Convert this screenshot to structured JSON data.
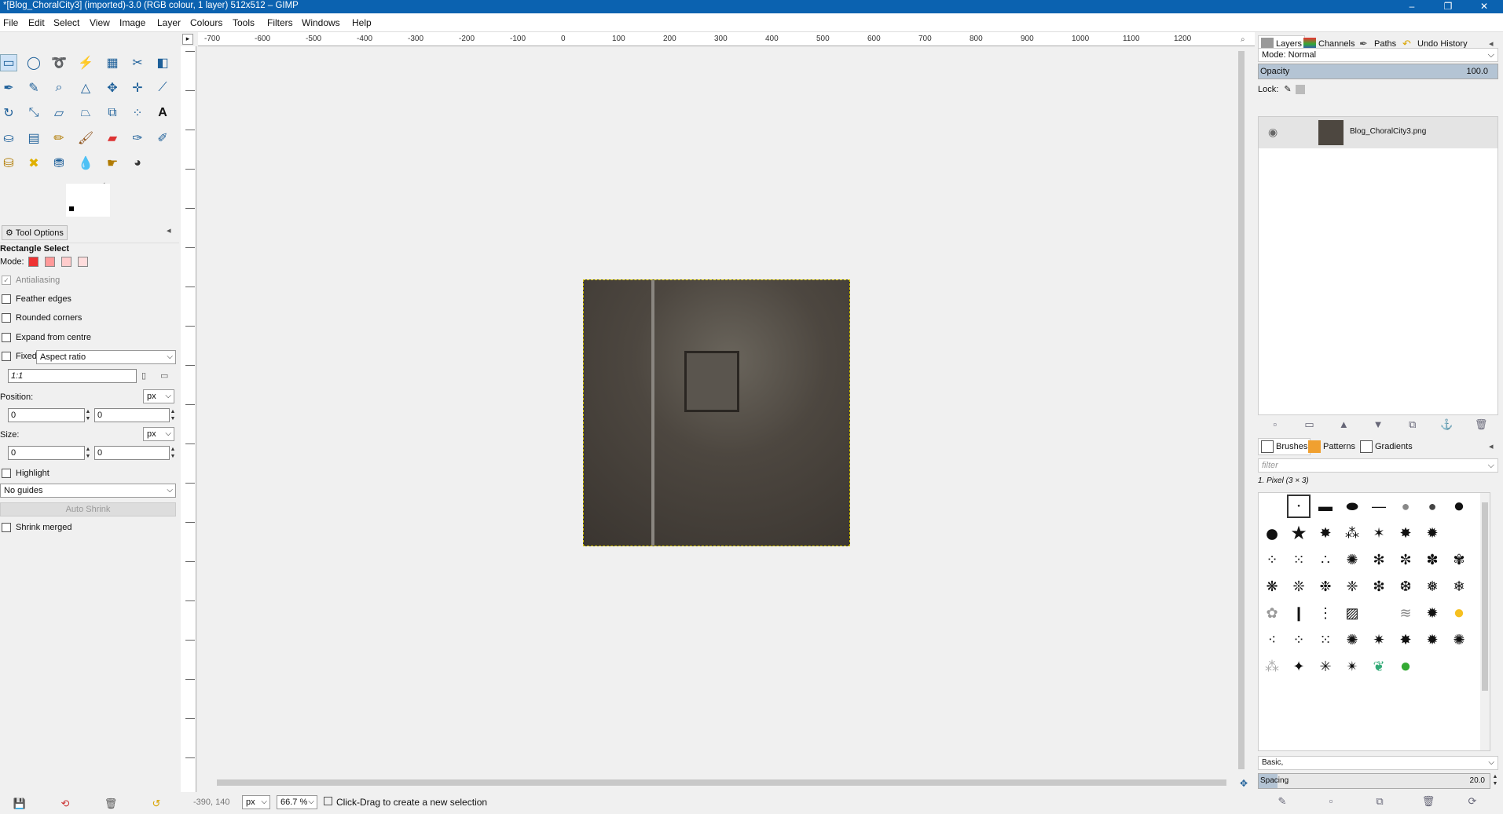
{
  "window": {
    "title": "*[Blog_ChoralCity3] (imported)-3.0 (RGB colour, 1 layer) 512x512 – GIMP",
    "minimize": "–",
    "maximize": "❐",
    "close": "✕"
  },
  "menu": [
    "File",
    "Edit",
    "Select",
    "View",
    "Image",
    "Layer",
    "Colours",
    "Tools",
    "Filters",
    "Windows",
    "Help"
  ],
  "toolbox": {
    "icons": [
      "rect-select-icon",
      "ellipse-select-icon",
      "free-select-icon",
      "fuzzy-select-icon",
      "color-select-icon",
      "scissors-icon",
      "foreground-select-icon",
      "paths-icon",
      "color-picker-icon",
      "zoom-icon",
      "measure-icon",
      "move-icon",
      "align-icon",
      "crop-icon",
      "rotate-icon",
      "scale-icon",
      "shear-icon",
      "perspective-icon",
      "transform-3d-icon",
      "unified-transform-icon",
      "handle-transform-icon",
      "warp-icon",
      "text-icon",
      "bucket-fill-icon",
      "gradient-icon",
      "pencil-icon",
      "paintbrush-icon",
      "eraser-icon",
      "airbrush-icon",
      "ink-icon",
      "clone-icon",
      "heal-icon",
      "perspective-clone-icon",
      "blur-icon",
      "smudge-icon",
      "dodge-icon"
    ]
  },
  "tool_options": {
    "tab_label": "Tool Options",
    "tool_name": "Rectangle Select",
    "mode_label": "Mode:",
    "antialiasing": "Antialiasing",
    "feather": "Feather edges",
    "rounded": "Rounded corners",
    "expand": "Expand from centre",
    "fixed_label": "Fixed:",
    "fixed_value": "Aspect ratio",
    "ratio_value": "1:1",
    "position_label": "Position:",
    "size_label": "Size:",
    "unit": "px",
    "pos_x": "0",
    "pos_y": "0",
    "size_w": "0",
    "size_h": "0",
    "highlight": "Highlight",
    "guides": "No guides",
    "auto_shrink": "Auto Shrink",
    "shrink_merged": "Shrink merged"
  },
  "ruler": {
    "ticks": [
      "-700",
      "-600",
      "-500",
      "-400",
      "-300",
      "-200",
      "-100",
      "0",
      "100",
      "200",
      "300",
      "400",
      "500",
      "600",
      "700",
      "800",
      "900",
      "1000",
      "1100",
      "1200"
    ]
  },
  "status": {
    "coords": "-390, 140",
    "unit": "px",
    "zoom": "66.7 %",
    "message": "Click-Drag to create a new selection"
  },
  "layers_panel": {
    "tabs": [
      "Layers",
      "Channels",
      "Paths",
      "Undo History"
    ],
    "mode_label": "Mode:",
    "mode_value": "Normal",
    "opacity_label": "Opacity",
    "opacity_value": "100.0",
    "opacity_fraction": 1.0,
    "lock_label": "Lock:",
    "layer_name": "Blog_ChoralCity3.png"
  },
  "brushes_panel": {
    "tabs": [
      "Brushes",
      "Patterns",
      "Gradients"
    ],
    "filter_placeholder": "filter",
    "selected_brush": "1. Pixel (3 × 3)",
    "preset": "Basic,",
    "spacing_label": "Spacing",
    "spacing_value": "20.0"
  },
  "colors": {
    "titlebar": "#0b62b0",
    "selection": "#d8c800"
  }
}
